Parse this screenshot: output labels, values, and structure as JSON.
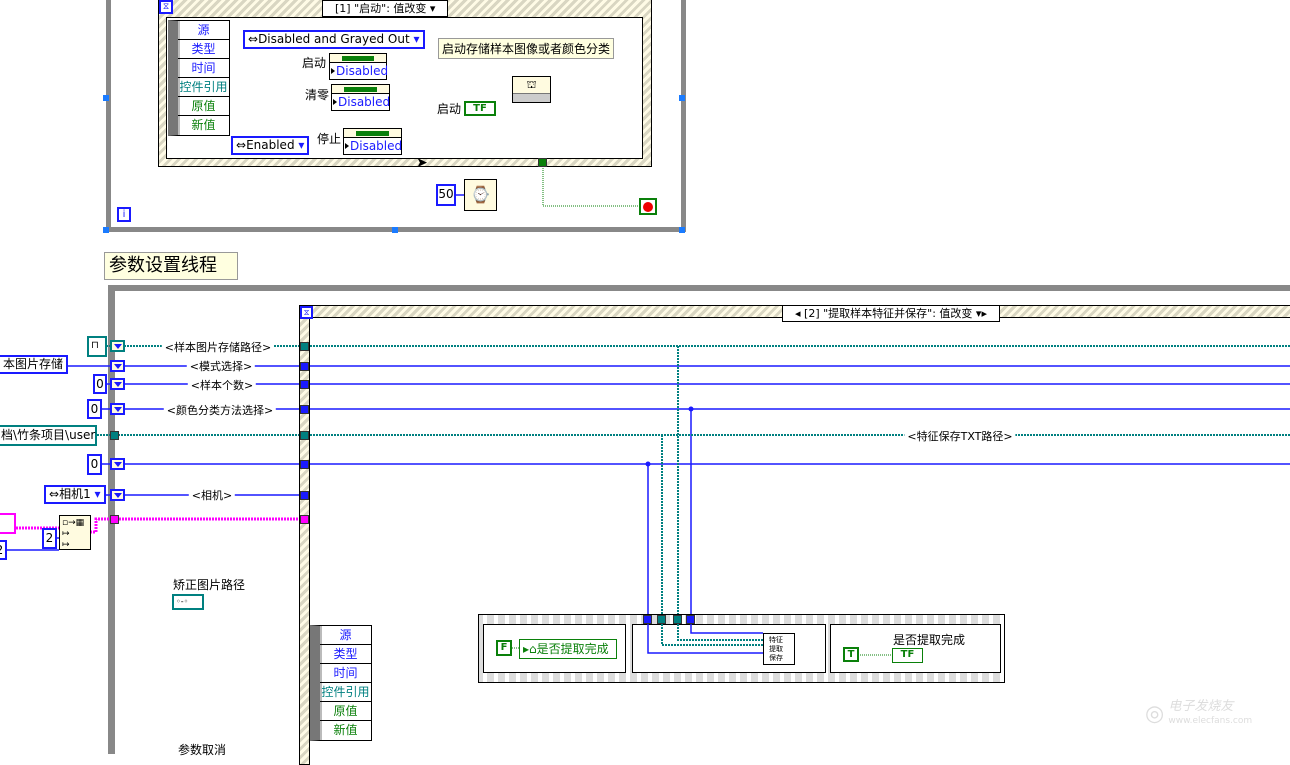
{
  "top_loop": {
    "event_selector": "[1] \"启动\": 值改变",
    "event_data_fields": [
      "源",
      "类型",
      "时间",
      "控件引用",
      "原值",
      "新值"
    ],
    "enum_disabled_grayed": "Disabled and Grayed Out",
    "enum_enabled": "Enabled",
    "property_nodes": [
      {
        "label": "启动",
        "value": "Disabled"
      },
      {
        "label": "清零",
        "value": "Disabled"
      },
      {
        "label": "停止",
        "value": "Disabled"
      }
    ],
    "comment": "启动存储样本图像或者颜色分类",
    "start_label": "启动",
    "tf_text": "TF",
    "wait_ms": "50",
    "iteration_label": "i"
  },
  "section_label": "参数设置线程",
  "bottom_loop": {
    "event_selector": "[2] \"提取样本特征并保存\": 值改变",
    "inputs": {
      "mode_enum": "本图片存储",
      "sample_count": "0",
      "color_method": "0",
      "txt_path": "档\\竹条项目\\user",
      "zero_const": "0",
      "camera_enum": "相机1",
      "array_size": "2",
      "left_const": "2"
    },
    "wire_labels": [
      "<样本图片存储路径>",
      "<模式选择>",
      "<样本个数>",
      "<颜色分类方法选择>",
      "<特征保存TXT路径>",
      "<相机>"
    ],
    "correct_path_label": "矫正图片路径",
    "cancel_label": "参数取消",
    "event_data_fields": [
      "源",
      "类型",
      "时间",
      "控件引用",
      "原值",
      "新值"
    ],
    "sequence": {
      "false_const": "F",
      "local_var": "是否提取完成",
      "subvi_text": "特征提取保存",
      "indicator_label": "是否提取完成",
      "true_const": "T",
      "tf_text": "TF"
    }
  },
  "watermark": {
    "brand": "电子发烧友",
    "url": "www.elecfans.com"
  },
  "colors": {
    "int_wire": "#1a1aff",
    "path_wire": "#008080",
    "bool_wire": "#0a800a",
    "cluster_wire": "#ff00ff"
  }
}
